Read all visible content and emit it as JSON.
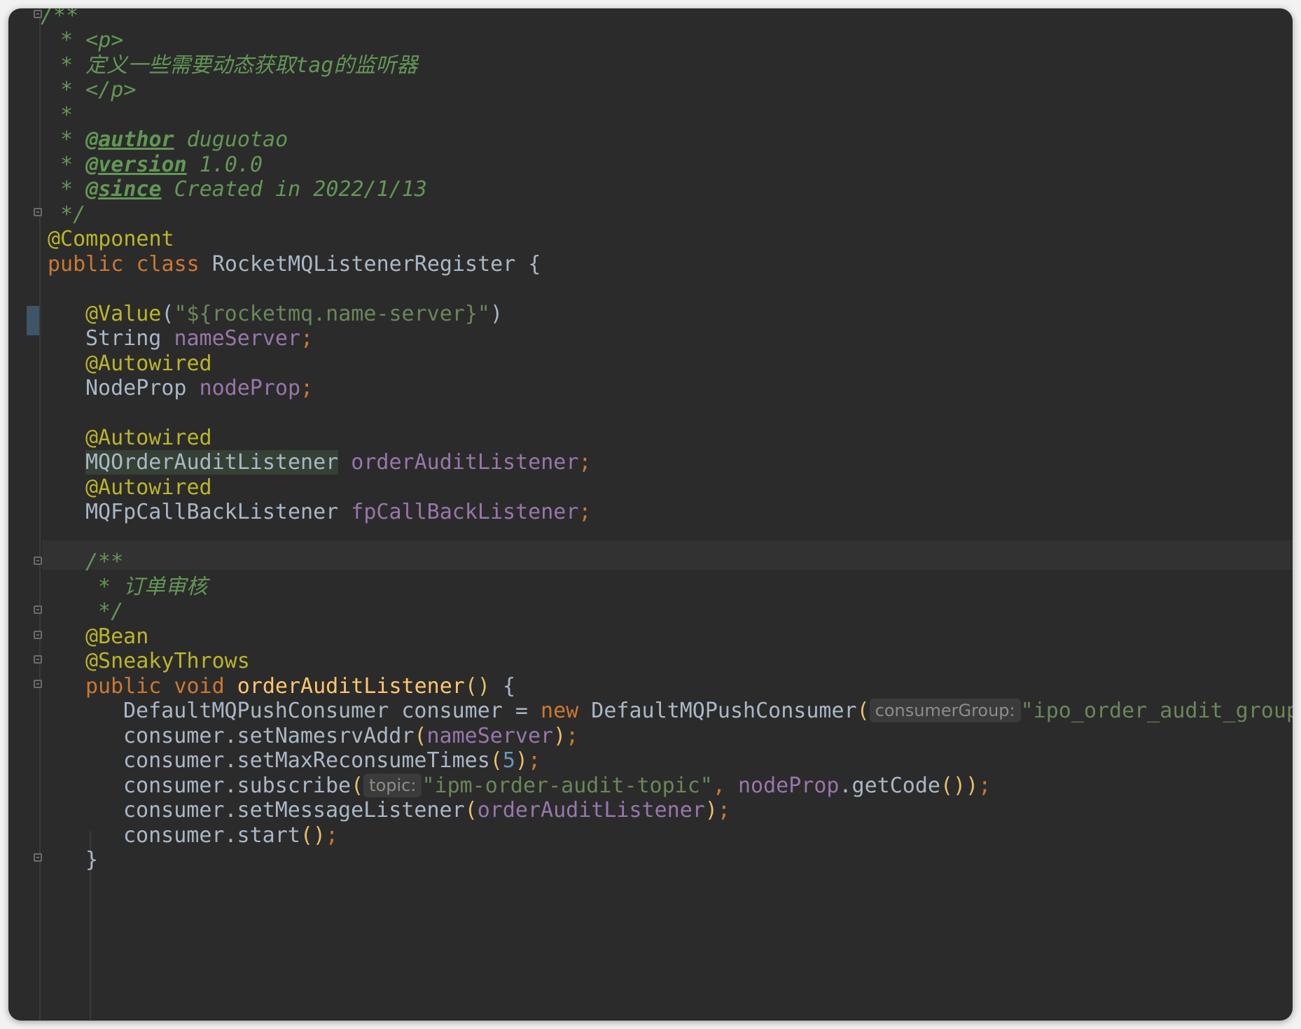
{
  "doc_comment": {
    "open": "/**",
    "p_open": " * <p>",
    "desc": " * 定义一些需要动态获取tag的监听器",
    "p_close": " * </p>",
    "blank": " *",
    "star": " * ",
    "author_tag": "@author",
    "author_value": " duguotao",
    "version_tag": "@version",
    "version_value": " 1.0.0",
    "since_tag": "@since",
    "since_value": " Created in 2022/1/13",
    "close": " */"
  },
  "class_decl": {
    "annotation": "@Component",
    "kw_public": "public",
    "kw_class": "class",
    "name": "RocketMQListenerRegister",
    "brace": "{"
  },
  "fields": {
    "value_ann": "@Value",
    "value_lp": "(",
    "value_str": "\"${rocketmq.name-server}\"",
    "value_rp": ")",
    "name_server_type": "String",
    "name_server_var": "nameServer",
    "autowired": "@Autowired",
    "node_prop_type": "NodeProp",
    "node_prop_var": "nodeProp",
    "order_listener_type": "MQOrderAuditListener",
    "order_listener_var": "orderAuditListener",
    "fp_listener_type": "MQFpCallBackListener",
    "fp_listener_var": "fpCallBackListener",
    "semi": ";"
  },
  "method_doc": {
    "open": "/**",
    "desc": " * 订单审核",
    "close": " */"
  },
  "method_decl": {
    "bean": "@Bean",
    "sneaky": "@SneakyThrows",
    "kw_public": "public",
    "kw_void": "void",
    "name": "orderAuditListener",
    "parens": "()",
    "brace": "{"
  },
  "body": {
    "consumer_type": "DefaultMQPushConsumer",
    "consumer_var": "consumer",
    "eq": "=",
    "kw_new": "new",
    "ctor": "DefaultMQPushConsumer",
    "hint_group": "consumerGroup:",
    "group_str": "\"ipo_order_audit_group\"",
    "call_set_namesrv": "consumer.setNamesrvAddr",
    "arg_name_server": "nameServer",
    "call_set_max": "consumer.setMaxReconsumeTimes",
    "arg_five": "5",
    "call_subscribe": "consumer.subscribe",
    "hint_topic": "topic:",
    "topic_str": "\"ipm-order-audit-topic\"",
    "comma": ",",
    "arg_node_prop": "nodeProp",
    "get_code": ".getCode",
    "call_set_listener": "consumer.setMessageListener",
    "arg_order_listener": "orderAuditListener",
    "call_start": "consumer.start",
    "close_brace": "}"
  }
}
